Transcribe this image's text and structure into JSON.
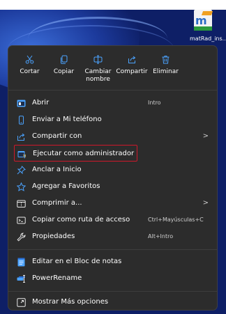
{
  "desktop": {
    "icon_label": "matRad_ins..."
  },
  "toolbar": [
    {
      "label": "Cortar",
      "icon": "scissors-icon"
    },
    {
      "label": "Copiar",
      "icon": "copy-icon"
    },
    {
      "label": "Cambiar nombre",
      "icon": "rename-icon"
    },
    {
      "label": "Compartir",
      "icon": "share-icon"
    },
    {
      "label": "Eliminar",
      "icon": "trash-icon"
    }
  ],
  "menu": {
    "items": [
      {
        "label": "Abrir",
        "shortcut": "Intro",
        "icon": "app-window-icon"
      },
      {
        "label": "Enviar a Mi teléfono",
        "icon": "phone-icon"
      },
      {
        "label": "Compartir con",
        "arrow": ">",
        "icon": "share-with-icon"
      },
      {
        "label": "Ejecutar como administrador",
        "icon": "admin-shield-icon",
        "highlighted": true
      },
      {
        "label": "Anclar a Inicio",
        "icon": "pin-icon"
      },
      {
        "label": "Agregar a Favoritos",
        "icon": "star-icon"
      },
      {
        "label": "Comprimir a...",
        "arrow": ">",
        "icon": "archive-icon"
      },
      {
        "label": "Copiar como ruta de acceso",
        "shortcut": "Ctrl+Mayúsculas+C",
        "icon": "path-copy-icon"
      },
      {
        "label": "Propiedades",
        "shortcut": "Alt+Intro",
        "icon": "wrench-icon"
      },
      {
        "label": "Editar en el Bloc de notas",
        "icon": "notepad-icon"
      },
      {
        "label": "PowerRename",
        "icon": "powerrename-icon"
      },
      {
        "label": "Mostrar Más opciones",
        "icon": "more-options-icon"
      }
    ]
  },
  "colors": {
    "menu_bg": "#2c2c2c",
    "highlight_border": "#d0182b",
    "accent_blue": "#4ba3ff"
  }
}
